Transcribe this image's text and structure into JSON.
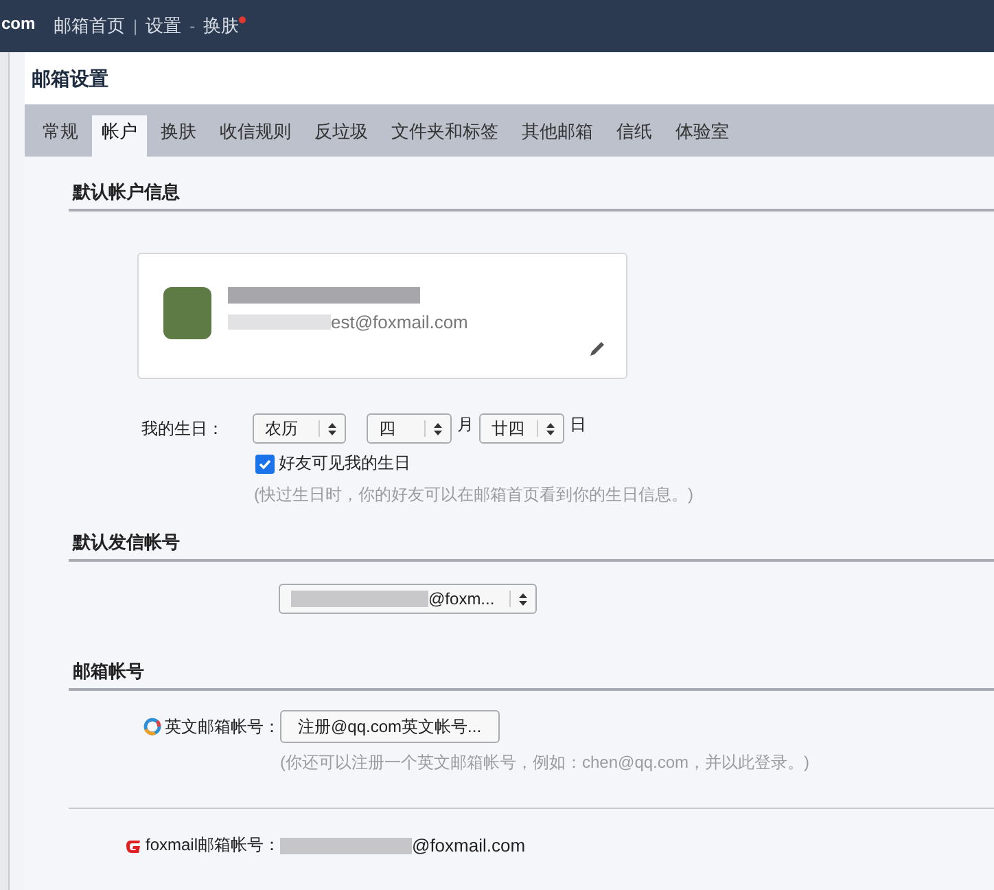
{
  "header": {
    "logo_text": "com",
    "nav": [
      {
        "label": "邮箱首页"
      },
      {
        "separator": "|",
        "label": "设置"
      },
      {
        "separator": "-",
        "label": "换肤",
        "new_dot": true
      }
    ]
  },
  "page_title": "邮箱设置",
  "tabs": [
    {
      "label": "常规",
      "selected": false
    },
    {
      "label": "帐户",
      "selected": true
    },
    {
      "label": "换肤",
      "selected": false
    },
    {
      "label": "收信规则",
      "selected": false
    },
    {
      "label": "反垃圾",
      "selected": false
    },
    {
      "label": "文件夹和标签",
      "selected": false
    },
    {
      "label": "其他邮箱",
      "selected": false
    },
    {
      "label": "信纸",
      "selected": false
    },
    {
      "label": "体验室",
      "selected": false
    }
  ],
  "default_account": {
    "heading": "默认帐户信息",
    "profile_card": {
      "email_suffix": "est@foxmail.com"
    },
    "birthday": {
      "label": "我的生日：",
      "calendar": "农历",
      "month": "四",
      "month_unit": "月",
      "day": "廿四",
      "day_unit": "日",
      "visible_checkbox": {
        "label": "好友可见我的生日",
        "checked": true
      },
      "hint": "(快过生日时，你的好友可以在邮箱首页看到你的生日信息。)"
    }
  },
  "default_sender": {
    "heading": "默认发信帐号",
    "select_value": "@foxm..."
  },
  "mail_accounts": {
    "heading": "邮箱帐号",
    "rows": [
      {
        "kind": "english",
        "label": "英文邮箱帐号：",
        "button": "注册@qq.com英文帐号...",
        "hint": "(你还可以注册一个英文邮箱帐号，例如：chen@qq.com，并以此登录。)"
      },
      {
        "kind": "foxmail",
        "label": "foxmail邮箱帐号：",
        "value_suffix": "@foxmail.com"
      }
    ]
  }
}
